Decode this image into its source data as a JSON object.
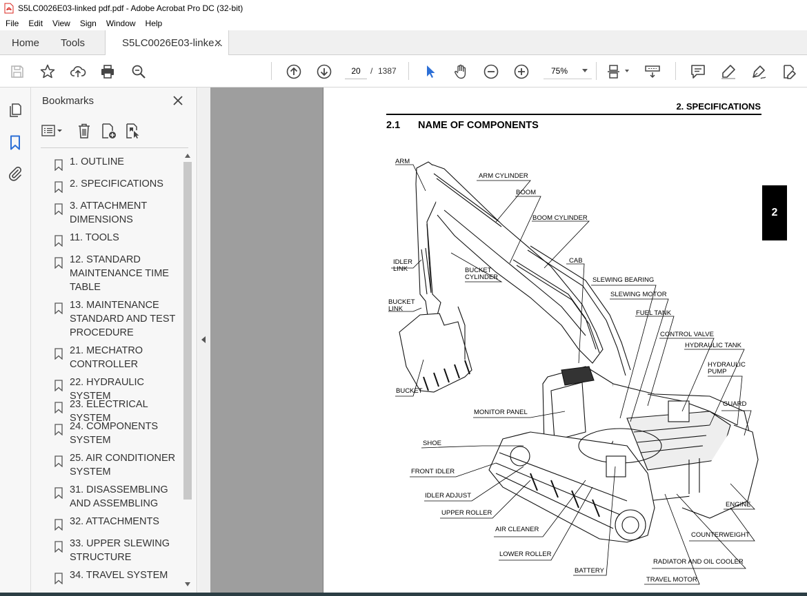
{
  "window": {
    "title": "S5LC0026E03-linked pdf.pdf - Adobe Acrobat Pro DC (32-bit)"
  },
  "menu": [
    "File",
    "Edit",
    "View",
    "Sign",
    "Window",
    "Help"
  ],
  "tabs": {
    "home": "Home",
    "tools": "Tools",
    "document": "S5LC0026E03-linke..."
  },
  "toolbar": {
    "current_page": "20",
    "page_separator": "/",
    "total_pages": "1387",
    "zoom": "75%"
  },
  "bookmarks": {
    "title": "Bookmarks",
    "items": [
      "1. OUTLINE",
      "2. SPECIFICATIONS",
      "3. ATTACHMENT DIMENSIONS",
      "11. TOOLS",
      "12. STANDARD MAINTENANCE TIME TABLE",
      "13. MAINTENANCE STANDARD AND TEST PROCEDURE",
      "21. MECHATRO CONTROLLER",
      "22. HYDRAULIC SYSTEM",
      "23. ELECTRICAL SYSTEM",
      "24. COMPONENTS SYSTEM",
      "25. AIR CONDITIONER SYSTEM",
      "31. DISASSEMBLING AND ASSEMBLING",
      "32. ATTACHMENTS",
      "33. UPPER SLEWING STRUCTURE",
      "34. TRAVEL SYSTEM"
    ]
  },
  "page": {
    "section_header": "2.  SPECIFICATIONS",
    "subtitle_number": "2.1",
    "subtitle_text": "NAME OF COMPONENTS",
    "chapter_tab": "2",
    "component_labels": {
      "arm": "ARM",
      "arm_cylinder": "ARM CYLINDER",
      "boom": "BOOM",
      "boom_cylinder": "BOOM CYLINDER",
      "idler_link_1": "IDLER",
      "idler_link_2": "LINK",
      "bucket_cylinder_1": "BUCKET",
      "bucket_cylinder_2": "CYLINDER",
      "cab": "CAB",
      "slewing_bearing": "SLEWING BEARING",
      "bucket_link_1": "BUCKET",
      "bucket_link_2": "LINK",
      "slewing_motor": "SLEWING MOTOR",
      "fuel_tank": "FUEL TANK",
      "control_valve": "CONTROL VALVE",
      "hydraulic_tank": "HYDRAULIC TANK",
      "hydraulic_pump_1": "HYDRAULIC",
      "hydraulic_pump_2": "PUMP",
      "bucket": "BUCKET",
      "guard": "GUARD",
      "monitor_panel": "MONITOR PANEL",
      "shoe": "SHOE",
      "front_idler": "FRONT IDLER",
      "idler_adjust": "IDLER ADJUST",
      "engine": "ENGINE",
      "upper_roller": "UPPER ROLLER",
      "air_cleaner": "AIR CLEANER",
      "counterweight": "COUNTERWEIGHT",
      "lower_roller": "LOWER ROLLER",
      "radiator": "RADIATOR AND OIL COOLER",
      "battery": "BATTERY",
      "travel_motor": "TRAVEL MOTOR"
    }
  }
}
